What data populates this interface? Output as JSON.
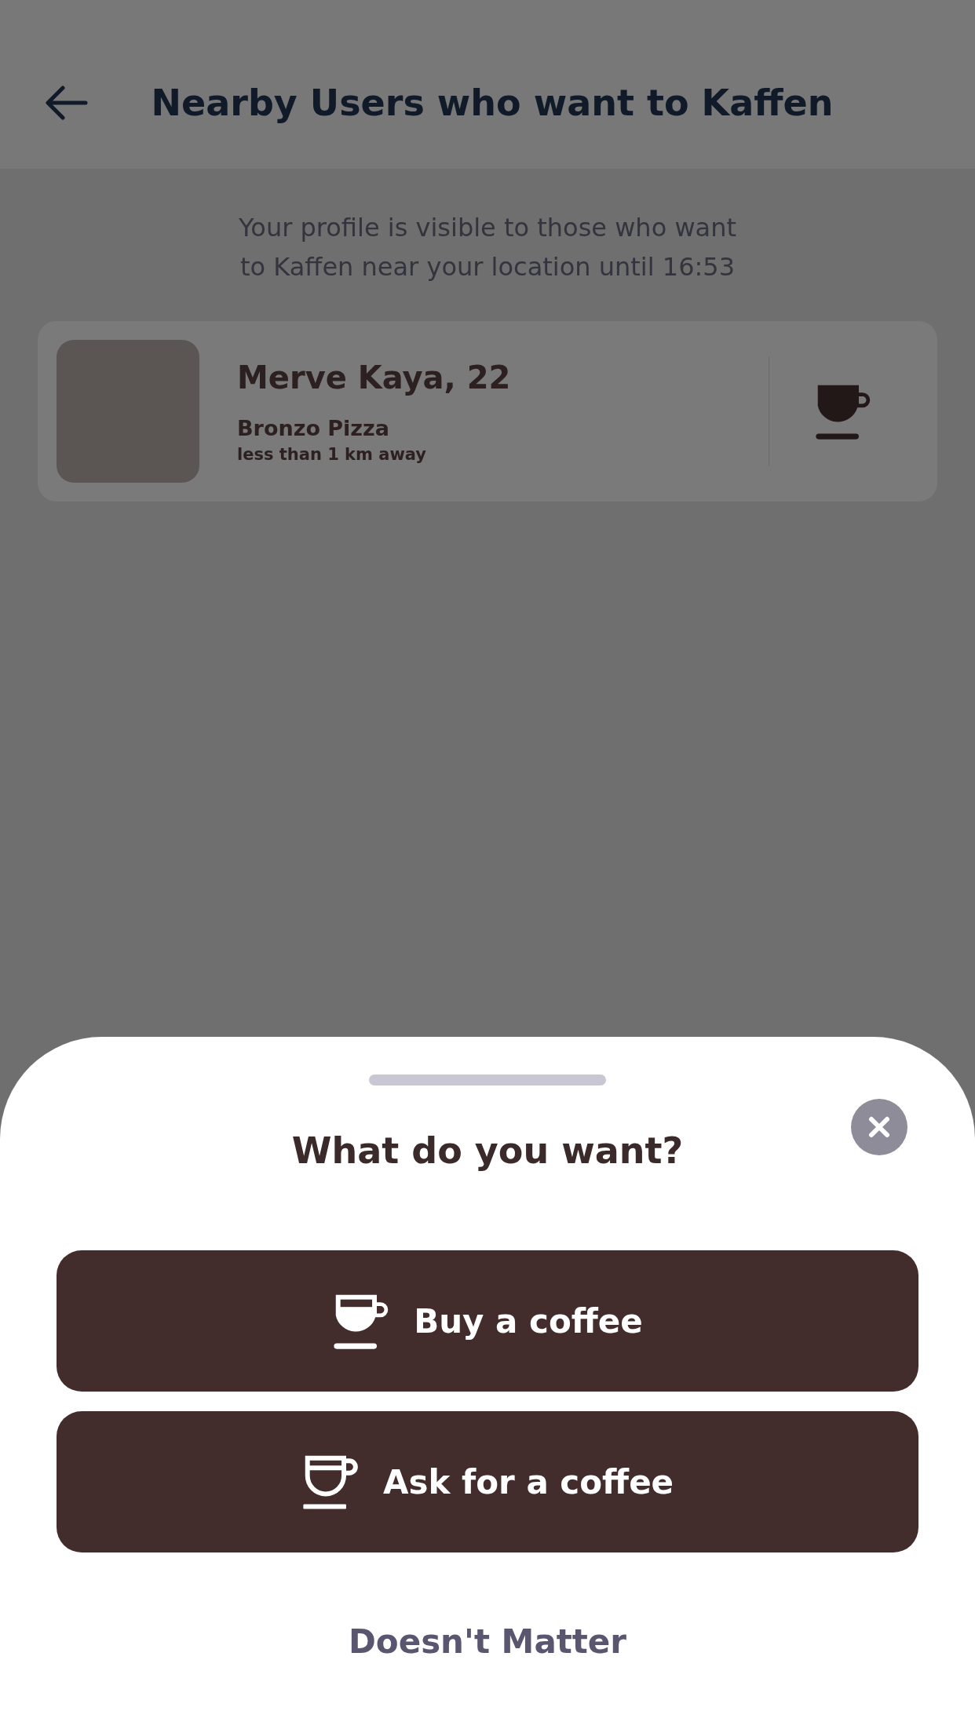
{
  "header": {
    "title": "Nearby Users who want to Kaffen"
  },
  "notice": {
    "lines": [
      "Your profile is visible to those who want",
      "to Kaffen near your location until 16:53"
    ]
  },
  "users": [
    {
      "name": "Merve Kaya, 22",
      "place": "Bronzo Pizza",
      "distance": "less than 1 km away"
    }
  ],
  "sheet": {
    "title": "What do you want?",
    "options": [
      {
        "label": "Buy a coffee",
        "kind": "filled"
      },
      {
        "label": "Ask for a coffee",
        "kind": "outline"
      }
    ],
    "secondary": "Doesn't Matter"
  }
}
